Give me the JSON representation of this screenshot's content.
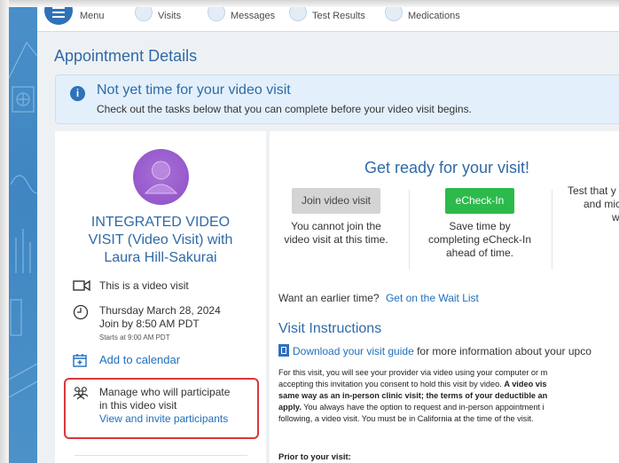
{
  "nav": {
    "menu": "Menu",
    "visits": "Visits",
    "messages": "Messages",
    "test_results": "Test Results",
    "medications": "Medications"
  },
  "page": {
    "title": "Appointment Details"
  },
  "alert": {
    "title": "Not yet time for your video visit",
    "subtitle": "Check out the tasks below that you can complete before your video visit begins."
  },
  "visit": {
    "title_line1": "INTEGRATED VIDEO",
    "title_line2": "VISIT (Video Visit) with",
    "title_line3": "Laura Hill-Sakurai",
    "type_label": "This is a video visit",
    "date": "Thursday March 28, 2024",
    "join_by": "Join by 8:50 AM PDT",
    "starts_at": "Starts at 9:00 AM PDT",
    "add_calendar": "Add to calendar",
    "manage_line1": "Manage who will participate",
    "manage_line2": "in this video visit",
    "invite_link": "View and invite participants"
  },
  "ready": {
    "title": "Get ready for your visit!",
    "join_button": "Join video visit",
    "join_line1": "You cannot join the",
    "join_line2": "video visit at this time.",
    "echeckin_button": "eCheck-In",
    "echeckin_line1": "Save time by",
    "echeckin_line2": "completing eCheck-In",
    "echeckin_line3": "ahead of time.",
    "test_line1": "Test that y",
    "test_line2": "and micr",
    "test_line3": "wo"
  },
  "earlier": {
    "text": "Want an earlier time?",
    "link": "Get on the Wait List"
  },
  "instructions": {
    "title": "Visit Instructions",
    "guide_link": "Download your visit guide",
    "guide_rest": "for more information about your upco",
    "p_line1": "For this visit, you will see your provider via video using your computer or m",
    "p_line2_a": "accepting this invitation you consent to hold this visit by video.",
    "p_line2_b": "A video vis",
    "p_line3": "same way as an in-person clinic visit; the terms of your deductible an",
    "p_line4_a": "apply.",
    "p_line4_b": "You always have the option to request and in-person appointment i",
    "p_line5": "following, a video visit. You must be in California at the time of the visit.",
    "prior": "Prior to your visit:"
  },
  "colors": {
    "brand_blue": "#2f6aa7",
    "link_blue": "#1f6fbf",
    "green": "#2cba4b",
    "alert_bg": "#e3f0fb",
    "highlight_red": "#d9373c"
  }
}
